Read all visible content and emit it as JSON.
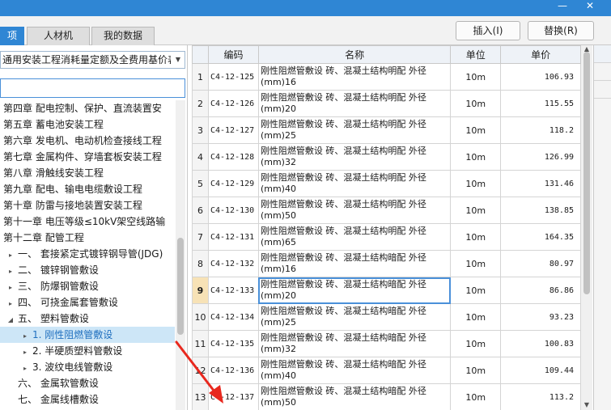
{
  "window": {
    "minimize": "—",
    "close": "✕"
  },
  "tabs": [
    {
      "label": "项",
      "active": true
    },
    {
      "label": "人材机",
      "active": false
    },
    {
      "label": "我的数据",
      "active": false
    }
  ],
  "toolbar": {
    "insert_label": "插入(I)",
    "replace_label": "替换(R)"
  },
  "library": {
    "selected": "通用安装工程消耗量定额及全费用基价表"
  },
  "search": {
    "value": ""
  },
  "tree": [
    {
      "label": "第四章 配电控制、保护、直流装置安",
      "indent": 0,
      "arrow": ""
    },
    {
      "label": "第五章 蓄电池安装工程",
      "indent": 0,
      "arrow": ""
    },
    {
      "label": "第六章 发电机、电动机检查接线工程",
      "indent": 0,
      "arrow": ""
    },
    {
      "label": "第七章 金属构件、穿墙套板安装工程",
      "indent": 0,
      "arrow": ""
    },
    {
      "label": "第八章 滑触线安装工程",
      "indent": 0,
      "arrow": ""
    },
    {
      "label": "第九章 配电、输电电缆敷设工程",
      "indent": 0,
      "arrow": ""
    },
    {
      "label": "第十章 防雷与接地装置安装工程",
      "indent": 0,
      "arrow": ""
    },
    {
      "label": "第十一章 电压等级≤10kV架空线路输",
      "indent": 0,
      "arrow": ""
    },
    {
      "label": "第十二章 配管工程",
      "indent": 0,
      "arrow": ""
    },
    {
      "label": "一、 套接紧定式镀锌钢导管(JDG)",
      "indent": 1,
      "arrow": "▸"
    },
    {
      "label": "二、 镀锌钢管敷设",
      "indent": 1,
      "arrow": "▸"
    },
    {
      "label": "三、 防爆钢管敷设",
      "indent": 1,
      "arrow": "▸"
    },
    {
      "label": "四、 可挠金属套管敷设",
      "indent": 1,
      "arrow": "▸"
    },
    {
      "label": "五、 塑料管敷设",
      "indent": 1,
      "arrow": "◢"
    },
    {
      "label": "1. 刚性阻燃管敷设",
      "indent": 2,
      "arrow": "▸",
      "selected": true
    },
    {
      "label": "2. 半硬质塑料管敷设",
      "indent": 2,
      "arrow": "▸"
    },
    {
      "label": "3. 波纹电线管敷设",
      "indent": 2,
      "arrow": "▸"
    },
    {
      "label": "六、 金属软管敷设",
      "indent": 1,
      "arrow": ""
    },
    {
      "label": "七、 金属线槽敷设",
      "indent": 1,
      "arrow": ""
    }
  ],
  "grid": {
    "headers": {
      "index": "",
      "code": "编码",
      "name": "名称",
      "unit": "单位",
      "price": "单价"
    },
    "rows": [
      {
        "idx": "1",
        "code": "C4-12-125",
        "name": "刚性阻燃管敷设 砖、混凝土结构明配 外径(mm)16",
        "unit": "10m",
        "price": "106.93"
      },
      {
        "idx": "2",
        "code": "C4-12-126",
        "name": "刚性阻燃管敷设 砖、混凝土结构明配 外径(mm)20",
        "unit": "10m",
        "price": "115.55"
      },
      {
        "idx": "3",
        "code": "C4-12-127",
        "name": "刚性阻燃管敷设 砖、混凝土结构明配 外径(mm)25",
        "unit": "10m",
        "price": "118.2"
      },
      {
        "idx": "4",
        "code": "C4-12-128",
        "name": "刚性阻燃管敷设 砖、混凝土结构明配 外径(mm)32",
        "unit": "10m",
        "price": "126.99"
      },
      {
        "idx": "5",
        "code": "C4-12-129",
        "name": "刚性阻燃管敷设 砖、混凝土结构明配 外径(mm)40",
        "unit": "10m",
        "price": "131.46"
      },
      {
        "idx": "6",
        "code": "C4-12-130",
        "name": "刚性阻燃管敷设 砖、混凝土结构明配 外径(mm)50",
        "unit": "10m",
        "price": "138.85"
      },
      {
        "idx": "7",
        "code": "C4-12-131",
        "name": "刚性阻燃管敷设 砖、混凝土结构明配 外径(mm)65",
        "unit": "10m",
        "price": "164.35"
      },
      {
        "idx": "8",
        "code": "C4-12-132",
        "name": "刚性阻燃管敷设 砖、混凝土结构暗配 外径(mm)16",
        "unit": "10m",
        "price": "80.97"
      },
      {
        "idx": "9",
        "code": "C4-12-133",
        "name": "刚性阻燃管敷设 砖、混凝土结构暗配 外径(mm)20",
        "unit": "10m",
        "price": "86.86",
        "current": true
      },
      {
        "idx": "10",
        "code": "C4-12-134",
        "name": "刚性阻燃管敷设 砖、混凝土结构暗配 外径(mm)25",
        "unit": "10m",
        "price": "93.23"
      },
      {
        "idx": "11",
        "code": "C4-12-135",
        "name": "刚性阻燃管敷设 砖、混凝土结构暗配 外径(mm)32",
        "unit": "10m",
        "price": "100.83"
      },
      {
        "idx": "12",
        "code": "C4-12-136",
        "name": "刚性阻燃管敷设 砖、混凝土结构暗配 外径(mm)40",
        "unit": "10m",
        "price": "109.44"
      },
      {
        "idx": "13",
        "code": "C4-12-137",
        "name": "刚性阻燃管敷设 砖、混凝土结构暗配 外径(mm)50",
        "unit": "10m",
        "price": "113.2"
      }
    ]
  },
  "colors": {
    "accent": "#2f86d4",
    "selected_row": "#cde6f7",
    "current_index": "#f7e2b6",
    "annotation": "#e8281e"
  },
  "icons": {
    "combo": "chevron-down-icon",
    "tree_collapsed": "triangle-right-icon",
    "tree_expanded": "triangle-down-icon",
    "annotation": "red-arrow-icon"
  }
}
